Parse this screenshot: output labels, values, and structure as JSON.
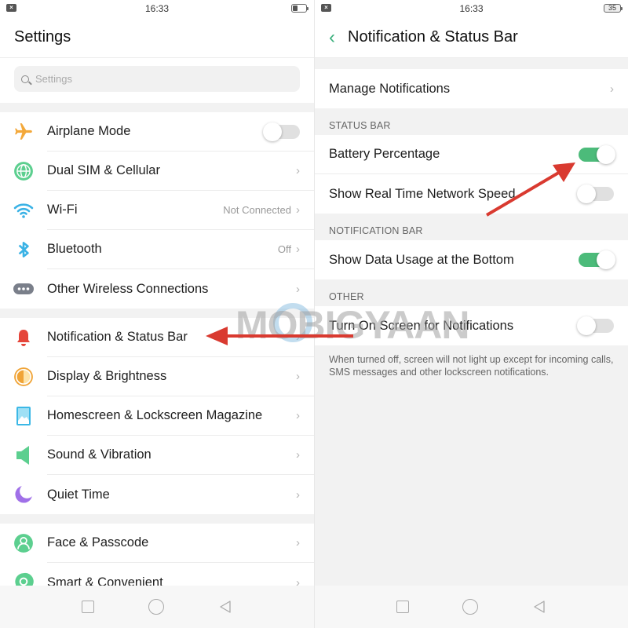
{
  "left": {
    "status_bar": {
      "time": "16:33",
      "notif_icon": "x-notification-icon"
    },
    "header": {
      "title": "Settings"
    },
    "search": {
      "placeholder": "Settings"
    },
    "groups": [
      [
        {
          "label": "Airplane Mode",
          "icon": "airplane-icon",
          "control": "toggle",
          "on": false
        },
        {
          "label": "Dual SIM & Cellular",
          "icon": "globe-icon",
          "control": "chevron"
        },
        {
          "label": "Wi-Fi",
          "icon": "wifi-icon",
          "value": "Not Connected",
          "control": "chevron"
        },
        {
          "label": "Bluetooth",
          "icon": "bluetooth-icon",
          "value": "Off",
          "control": "chevron"
        },
        {
          "label": "Other Wireless Connections",
          "icon": "more-dots-icon",
          "control": "chevron"
        }
      ],
      [
        {
          "label": "Notification & Status Bar",
          "icon": "bell-icon",
          "control": "chevron"
        },
        {
          "label": "Display & Brightness",
          "icon": "brightness-icon",
          "control": "chevron"
        },
        {
          "label": "Homescreen & Lockscreen Magazine",
          "icon": "picture-icon",
          "control": "chevron"
        },
        {
          "label": "Sound & Vibration",
          "icon": "speaker-icon",
          "control": "chevron"
        },
        {
          "label": "Quiet Time",
          "icon": "moon-icon",
          "control": "chevron"
        }
      ],
      [
        {
          "label": "Face & Passcode",
          "icon": "face-user-icon",
          "control": "chevron"
        },
        {
          "label": "Smart & Convenient",
          "icon": "smart-icon",
          "control": "chevron"
        }
      ]
    ],
    "chevron": "›"
  },
  "right": {
    "status_bar": {
      "time": "16:33",
      "battery": "35"
    },
    "header": {
      "title": "Notification & Status Bar",
      "back": "‹"
    },
    "manage": {
      "label": "Manage Notifications"
    },
    "sections": {
      "status_bar": {
        "heading": "STATUS BAR",
        "items": [
          {
            "label": "Battery Percentage",
            "on": true
          },
          {
            "label": "Show Real Time Network Speed",
            "on": false
          }
        ]
      },
      "notification_bar": {
        "heading": "NOTIFICATION BAR",
        "items": [
          {
            "label": "Show Data Usage at the Bottom",
            "on": true
          }
        ]
      },
      "other": {
        "heading": "OTHER",
        "items": [
          {
            "label": "Turn On Screen for Notifications",
            "on": false
          }
        ],
        "footnote": "When turned off, screen will not light up except for incoming calls, SMS messages and other lockscreen notifications."
      }
    },
    "chevron": "›"
  },
  "watermark": "MOBIGYAAN",
  "colors": {
    "accent": "#3db07e",
    "toggle_on": "#4cbb7a",
    "arrow": "#d93a30"
  }
}
